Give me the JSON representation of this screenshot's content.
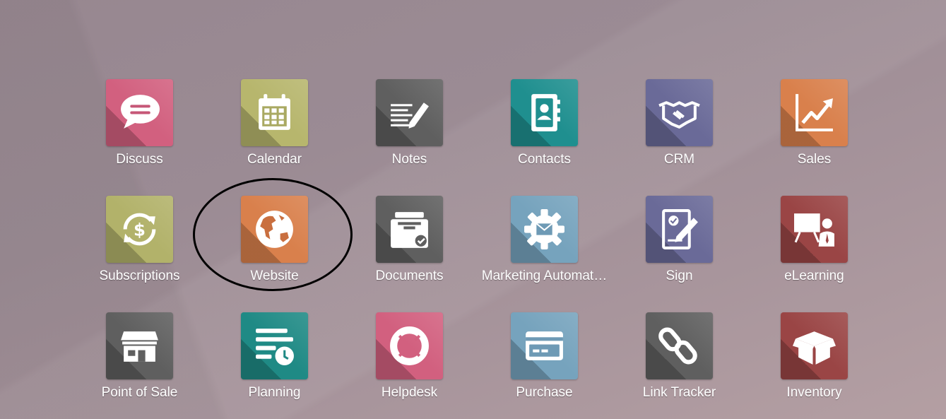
{
  "apps": [
    {
      "label": "Discuss",
      "icon": "chat-bubble-icon",
      "color": "#d2607f"
    },
    {
      "label": "Calendar",
      "icon": "calendar-icon",
      "color": "#b7b66d"
    },
    {
      "label": "Notes",
      "icon": "notes-pen-icon",
      "color": "#5f5f5f"
    },
    {
      "label": "Contacts",
      "icon": "address-book-icon",
      "color": "#1f8f8f"
    },
    {
      "label": "CRM",
      "icon": "handshake-icon",
      "color": "#6a6a98"
    },
    {
      "label": "Sales",
      "icon": "line-chart-icon",
      "color": "#d9804c"
    },
    {
      "label": "Subscriptions",
      "icon": "recurring-dollar-icon",
      "color": "#b2b26a"
    },
    {
      "label": "Website",
      "icon": "globe-icon",
      "color": "#d9804c"
    },
    {
      "label": "Documents",
      "icon": "file-box-icon",
      "color": "#5f5f5f"
    },
    {
      "label": "Marketing Automat…",
      "icon": "gear-envelope-icon",
      "color": "#76a3bd"
    },
    {
      "label": "Sign",
      "icon": "sign-document-icon",
      "color": "#6a6a98"
    },
    {
      "label": "eLearning",
      "icon": "presentation-icon",
      "color": "#9a4545"
    },
    {
      "label": "Point of Sale",
      "icon": "shop-icon",
      "color": "#5f5f5f"
    },
    {
      "label": "Planning",
      "icon": "planning-clock-icon",
      "color": "#1f8a85"
    },
    {
      "label": "Helpdesk",
      "icon": "lifebuoy-icon",
      "color": "#d2607f"
    },
    {
      "label": "Purchase",
      "icon": "credit-card-icon",
      "color": "#76a3bd"
    },
    {
      "label": "Link Tracker",
      "icon": "chain-link-icon",
      "color": "#5f5f5f"
    },
    {
      "label": "Inventory",
      "icon": "open-box-icon",
      "color": "#9a4545"
    }
  ]
}
